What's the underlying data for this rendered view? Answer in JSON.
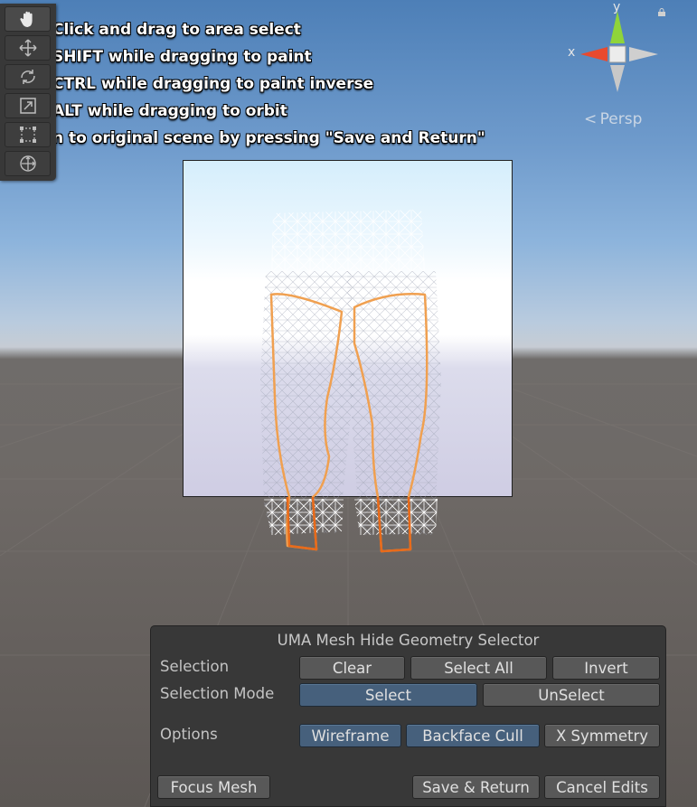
{
  "instructions": [
    "Click and drag to area select",
    "SHIFT while dragging to paint",
    "CTRL while dragging to paint inverse",
    "ALT while dragging to orbit",
    "n to original scene by pressing \"Save and Return\""
  ],
  "toolbar": {
    "tools": [
      "hand-tool",
      "move-tool",
      "rotate-tool",
      "scale-tool",
      "rect-tool",
      "transform-tool"
    ]
  },
  "gizmo": {
    "x_label": "x",
    "y_label": "y",
    "projection": "Persp",
    "colors": {
      "x": "#e84a2e",
      "y": "#8fd43a",
      "neutral": "#cfcfcf"
    }
  },
  "panel": {
    "title": "UMA Mesh Hide Geometry Selector",
    "selection_label": "Selection",
    "clear_label": "Clear",
    "select_all_label": "Select All",
    "invert_label": "Invert",
    "selection_mode_label": "Selection Mode",
    "select_label": "Select",
    "unselect_label": "UnSelect",
    "options_label": "Options",
    "wireframe_label": "Wireframe",
    "backface_cull_label": "Backface Cull",
    "x_symmetry_label": "X Symmetry",
    "focus_mesh_label": "Focus Mesh",
    "save_return_label": "Save & Return",
    "cancel_edits_label": "Cancel Edits",
    "active_color": "#46607c"
  },
  "selection_outline_color": "#f0a050"
}
